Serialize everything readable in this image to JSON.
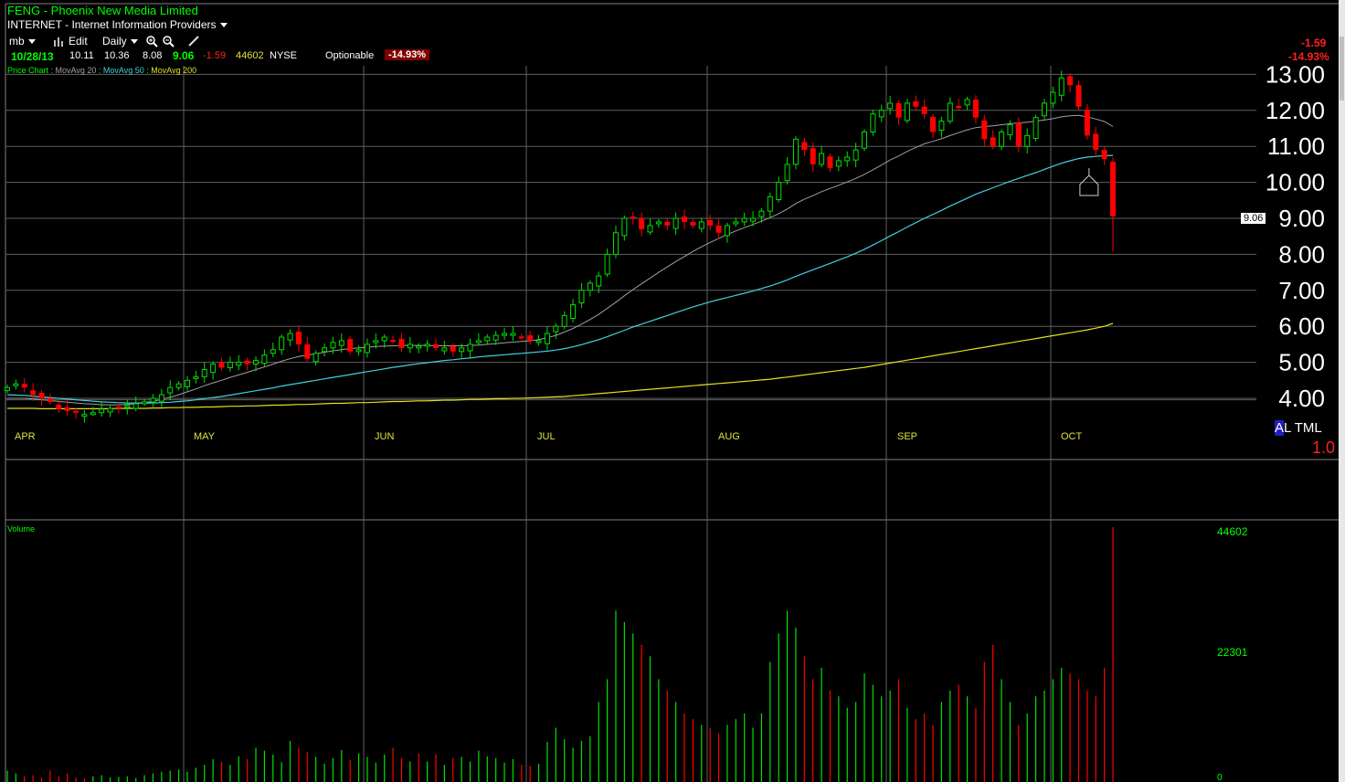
{
  "header": {
    "symbol_line": "FENG - Phoenix New Media Limited",
    "industry": "INTERNET - Internet Information Providers",
    "user": "mb",
    "edit_label": "Edit",
    "period": "Daily",
    "date": "10/28/13",
    "open": "10.11",
    "high": "10.36",
    "low": "8.08",
    "close": "9.06",
    "change": "-1.59",
    "volume": "44602",
    "exchange": "NYSE",
    "optionable": "Optionable",
    "pct_change": "-14.93%"
  },
  "legend": {
    "price_chart": "Price Chart : ",
    "ma20": "MovAvg 20",
    "ma50": "MovAvg 50",
    "ma200": "MovAvg 200",
    "sep": " : "
  },
  "right_panel": {
    "change": "-1.59",
    "pct": "-14.93%",
    "last_tag": "9.06",
    "altml_a": "A",
    "altml_rest": "L TML",
    "ratio": "1.0"
  },
  "volume_panel": {
    "label": "Volume",
    "max_label": "44602",
    "mid_label": "22301",
    "zero_label": "0"
  },
  "colors": {
    "up": "#00e000",
    "down": "#ff0000",
    "ma20": "#a0a0a0",
    "ma50": "#40d0e0",
    "ma200": "#e0e020",
    "grid": "#606060",
    "header_green": "#00ff00"
  },
  "chart_data": {
    "type": "candlestick",
    "ylim": [
      3.4,
      13.3
    ],
    "yticks": [
      "4.00",
      "5.00",
      "6.00",
      "7.00",
      "8.00",
      "9.00",
      "10.00",
      "11.00",
      "12.00",
      "13.00"
    ],
    "months": [
      "APR",
      "MAY",
      "JUN",
      "JUL",
      "AUG",
      "SEP",
      "OCT"
    ],
    "closes": [
      4.3,
      4.4,
      4.3,
      4.1,
      4.0,
      3.9,
      3.7,
      3.65,
      3.6,
      3.55,
      3.6,
      3.7,
      3.72,
      3.75,
      3.8,
      3.85,
      3.9,
      4.0,
      4.1,
      4.3,
      4.4,
      4.5,
      4.6,
      4.8,
      4.95,
      4.85,
      5.0,
      5.0,
      4.95,
      5.05,
      5.2,
      5.35,
      5.7,
      5.8,
      5.5,
      5.1,
      5.25,
      5.4,
      5.55,
      5.6,
      5.3,
      5.35,
      5.5,
      5.6,
      5.7,
      5.6,
      5.4,
      5.5,
      5.45,
      5.5,
      5.4,
      5.4,
      5.3,
      5.4,
      5.5,
      5.6,
      5.7,
      5.75,
      5.8,
      5.8,
      5.7,
      5.6,
      5.6,
      5.8,
      6.0,
      6.3,
      6.6,
      7.0,
      7.2,
      7.4,
      8.0,
      8.6,
      9.0,
      9.0,
      8.7,
      8.8,
      8.9,
      8.8,
      9.0,
      8.9,
      8.8,
      8.9,
      8.8,
      8.6,
      8.8,
      8.9,
      9.0,
      9.0,
      9.2,
      9.6,
      10.0,
      10.5,
      11.2,
      10.9,
      10.5,
      10.8,
      10.4,
      10.6,
      10.7,
      10.9,
      11.4,
      11.9,
      12.0,
      12.2,
      11.8,
      12.2,
      12.1,
      11.9,
      11.4,
      11.7,
      12.2,
      12.1,
      12.3,
      11.8,
      11.2,
      11.0,
      11.4,
      11.6,
      11.0,
      11.3,
      11.8,
      12.2,
      12.5,
      12.9,
      12.7,
      12.1,
      11.3,
      10.9,
      10.65,
      9.06
    ],
    "ma20": [
      4.0,
      4.0,
      4.0,
      3.98,
      3.96,
      3.94,
      3.91,
      3.89,
      3.87,
      3.85,
      3.84,
      3.82,
      3.82,
      3.82,
      3.83,
      3.85,
      3.88,
      3.92,
      3.97,
      4.03,
      4.1,
      4.18,
      4.26,
      4.35,
      4.43,
      4.5,
      4.58,
      4.65,
      4.72,
      4.8,
      4.87,
      4.95,
      5.03,
      5.1,
      5.16,
      5.2,
      5.24,
      5.28,
      5.32,
      5.35,
      5.38,
      5.4,
      5.42,
      5.44,
      5.45,
      5.46,
      5.47,
      5.47,
      5.47,
      5.47,
      5.46,
      5.46,
      5.46,
      5.46,
      5.47,
      5.48,
      5.5,
      5.52,
      5.54,
      5.56,
      5.58,
      5.6,
      5.63,
      5.68,
      5.75,
      5.84,
      5.94,
      6.06,
      6.19,
      6.33,
      6.5,
      6.67,
      6.85,
      7.02,
      7.18,
      7.34,
      7.5,
      7.65,
      7.8,
      7.94,
      8.08,
      8.21,
      8.33,
      8.44,
      8.55,
      8.65,
      8.74,
      8.83,
      8.92,
      9.02,
      9.13,
      9.26,
      9.41,
      9.53,
      9.63,
      9.74,
      9.83,
      9.92,
      10.01,
      10.11,
      10.22,
      10.35,
      10.48,
      10.62,
      10.73,
      10.86,
      10.97,
      11.07,
      11.14,
      11.21,
      11.3,
      11.38,
      11.46,
      11.52,
      11.55,
      11.57,
      11.6,
      11.63,
      11.65,
      11.67,
      11.7,
      11.73,
      11.77,
      11.82,
      11.85,
      11.86,
      11.82,
      11.76,
      11.69,
      11.55
    ],
    "ma50": [
      4.1,
      4.09,
      4.08,
      4.06,
      4.04,
      4.02,
      4.0,
      3.98,
      3.96,
      3.94,
      3.92,
      3.9,
      3.89,
      3.88,
      3.87,
      3.87,
      3.87,
      3.87,
      3.88,
      3.89,
      3.91,
      3.93,
      3.96,
      3.99,
      4.02,
      4.05,
      4.09,
      4.13,
      4.17,
      4.21,
      4.25,
      4.29,
      4.34,
      4.38,
      4.42,
      4.46,
      4.5,
      4.54,
      4.58,
      4.62,
      4.66,
      4.7,
      4.74,
      4.78,
      4.82,
      4.86,
      4.89,
      4.93,
      4.96,
      4.99,
      5.02,
      5.05,
      5.07,
      5.1,
      5.12,
      5.15,
      5.17,
      5.19,
      5.21,
      5.23,
      5.25,
      5.27,
      5.29,
      5.31,
      5.34,
      5.38,
      5.43,
      5.49,
      5.56,
      5.63,
      5.71,
      5.8,
      5.89,
      5.98,
      6.06,
      6.14,
      6.22,
      6.3,
      6.38,
      6.46,
      6.54,
      6.61,
      6.68,
      6.74,
      6.8,
      6.86,
      6.92,
      6.98,
      7.05,
      7.12,
      7.2,
      7.29,
      7.39,
      7.48,
      7.57,
      7.66,
      7.75,
      7.84,
      7.93,
      8.03,
      8.14,
      8.26,
      8.38,
      8.51,
      8.63,
      8.76,
      8.88,
      9.0,
      9.11,
      9.22,
      9.34,
      9.45,
      9.56,
      9.67,
      9.76,
      9.85,
      9.94,
      10.03,
      10.11,
      10.19,
      10.27,
      10.36,
      10.45,
      10.53,
      10.6,
      10.66,
      10.7,
      10.72,
      10.74,
      10.75
    ],
    "ma200": [
      3.72,
      3.72,
      3.72,
      3.72,
      3.71,
      3.71,
      3.71,
      3.71,
      3.71,
      3.71,
      3.71,
      3.71,
      3.71,
      3.72,
      3.72,
      3.72,
      3.72,
      3.73,
      3.73,
      3.74,
      3.74,
      3.75,
      3.75,
      3.76,
      3.76,
      3.77,
      3.78,
      3.78,
      3.79,
      3.79,
      3.8,
      3.81,
      3.81,
      3.82,
      3.83,
      3.83,
      3.84,
      3.85,
      3.86,
      3.86,
      3.87,
      3.88,
      3.88,
      3.89,
      3.9,
      3.91,
      3.91,
      3.92,
      3.93,
      3.93,
      3.94,
      3.95,
      3.95,
      3.96,
      3.97,
      3.97,
      3.98,
      3.99,
      3.99,
      4.0,
      4.0,
      4.01,
      4.02,
      4.03,
      4.04,
      4.05,
      4.07,
      4.09,
      4.11,
      4.13,
      4.15,
      4.17,
      4.19,
      4.21,
      4.23,
      4.25,
      4.27,
      4.29,
      4.31,
      4.33,
      4.35,
      4.37,
      4.39,
      4.41,
      4.43,
      4.45,
      4.47,
      4.49,
      4.51,
      4.53,
      4.56,
      4.59,
      4.62,
      4.65,
      4.68,
      4.71,
      4.74,
      4.77,
      4.8,
      4.83,
      4.86,
      4.9,
      4.94,
      4.98,
      5.02,
      5.06,
      5.1,
      5.14,
      5.18,
      5.22,
      5.26,
      5.3,
      5.34,
      5.38,
      5.42,
      5.46,
      5.5,
      5.54,
      5.58,
      5.62,
      5.66,
      5.7,
      5.74,
      5.78,
      5.82,
      5.86,
      5.9,
      5.95,
      6.0,
      6.08
    ],
    "volume": [
      2000,
      1500,
      1000,
      1200,
      800,
      2000,
      1000,
      1500,
      800,
      600,
      1000,
      1200,
      800,
      900,
      1000,
      700,
      1200,
      1500,
      1800,
      2000,
      2200,
      1800,
      2500,
      3000,
      4000,
      3500,
      3000,
      4500,
      4000,
      6000,
      5500,
      4800,
      3500,
      7200,
      6000,
      5200,
      4400,
      3200,
      4200,
      5600,
      3800,
      5000,
      4400,
      3400,
      4800,
      6000,
      4200,
      3600,
      5000,
      3600,
      4800,
      3000,
      4200,
      4400,
      3600,
      5500,
      4500,
      4200,
      3400,
      4000,
      3000,
      2800,
      3200,
      7000,
      9500,
      7500,
      6000,
      7200,
      8000,
      14000,
      18000,
      30000,
      28000,
      26000,
      24000,
      22000,
      18000,
      16000,
      14000,
      12000,
      11000,
      10000,
      9500,
      8500,
      10000,
      11000,
      12000,
      9500,
      12000,
      21000,
      26000,
      30000,
      27000,
      22000,
      18000,
      20000,
      16000,
      15000,
      13000,
      14000,
      19000,
      17000,
      15000,
      16000,
      18000,
      13000,
      11000,
      12000,
      10000,
      14000,
      16000,
      17000,
      15000,
      13000,
      21000,
      24000,
      18000,
      14000,
      10000,
      12000,
      15000,
      16000,
      18000,
      20000,
      19000,
      18000,
      16000,
      15000,
      20000,
      44602
    ]
  }
}
